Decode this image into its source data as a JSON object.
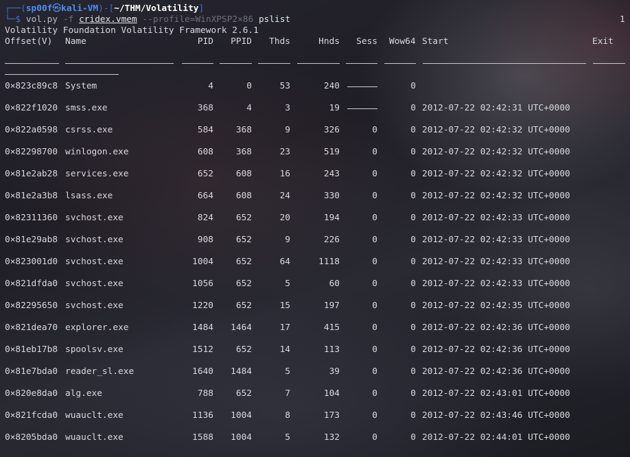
{
  "prompt": {
    "corner_top": "┌──(",
    "user": "sp00f",
    "skull": "㉿",
    "host": "kali-VM",
    "mid": ")-[",
    "path": "~/THM/Volatility",
    "close": "]",
    "corner_bottom": "└─",
    "dollar": "$",
    "cmd_vol": "vol.py",
    "cmd_flag": "-f",
    "cmd_file": "cridex.vmem",
    "cmd_profile": "--profile=WinXPSP2×86",
    "cmd_plugin": "pslist",
    "right_marker": "1"
  },
  "banner": "Volatility Foundation Volatility Framework 2.6.1",
  "headers": {
    "offset": "Offset(V)",
    "name": "Name",
    "pid": "PID",
    "ppid": "PPID",
    "thds": "Thds",
    "hnds": "Hnds",
    "sess": "Sess",
    "wow64": "Wow64",
    "start": "Start",
    "exit": "Exit"
  },
  "rows": [
    {
      "offset": "0×823c89c8",
      "name": "System",
      "pid": "4",
      "ppid": "0",
      "thds": "53",
      "hnds": "240",
      "sess": "",
      "wow64": "0",
      "start": ""
    },
    {
      "offset": "0×822f1020",
      "name": "smss.exe",
      "pid": "368",
      "ppid": "4",
      "thds": "3",
      "hnds": "19",
      "sess": "",
      "wow64": "0",
      "start": "2012-07-22 02:42:31 UTC+0000"
    },
    {
      "offset": "0×822a0598",
      "name": "csrss.exe",
      "pid": "584",
      "ppid": "368",
      "thds": "9",
      "hnds": "326",
      "sess": "0",
      "wow64": "0",
      "start": "2012-07-22 02:42:32 UTC+0000"
    },
    {
      "offset": "0×82298700",
      "name": "winlogon.exe",
      "pid": "608",
      "ppid": "368",
      "thds": "23",
      "hnds": "519",
      "sess": "0",
      "wow64": "0",
      "start": "2012-07-22 02:42:32 UTC+0000"
    },
    {
      "offset": "0×81e2ab28",
      "name": "services.exe",
      "pid": "652",
      "ppid": "608",
      "thds": "16",
      "hnds": "243",
      "sess": "0",
      "wow64": "0",
      "start": "2012-07-22 02:42:32 UTC+0000"
    },
    {
      "offset": "0×81e2a3b8",
      "name": "lsass.exe",
      "pid": "664",
      "ppid": "608",
      "thds": "24",
      "hnds": "330",
      "sess": "0",
      "wow64": "0",
      "start": "2012-07-22 02:42:32 UTC+0000"
    },
    {
      "offset": "0×82311360",
      "name": "svchost.exe",
      "pid": "824",
      "ppid": "652",
      "thds": "20",
      "hnds": "194",
      "sess": "0",
      "wow64": "0",
      "start": "2012-07-22 02:42:33 UTC+0000"
    },
    {
      "offset": "0×81e29ab8",
      "name": "svchost.exe",
      "pid": "908",
      "ppid": "652",
      "thds": "9",
      "hnds": "226",
      "sess": "0",
      "wow64": "0",
      "start": "2012-07-22 02:42:33 UTC+0000"
    },
    {
      "offset": "0×823001d0",
      "name": "svchost.exe",
      "pid": "1004",
      "ppid": "652",
      "thds": "64",
      "hnds": "1118",
      "sess": "0",
      "wow64": "0",
      "start": "2012-07-22 02:42:33 UTC+0000"
    },
    {
      "offset": "0×821dfda0",
      "name": "svchost.exe",
      "pid": "1056",
      "ppid": "652",
      "thds": "5",
      "hnds": "60",
      "sess": "0",
      "wow64": "0",
      "start": "2012-07-22 02:42:33 UTC+0000"
    },
    {
      "offset": "0×82295650",
      "name": "svchost.exe",
      "pid": "1220",
      "ppid": "652",
      "thds": "15",
      "hnds": "197",
      "sess": "0",
      "wow64": "0",
      "start": "2012-07-22 02:42:35 UTC+0000"
    },
    {
      "offset": "0×821dea70",
      "name": "explorer.exe",
      "pid": "1484",
      "ppid": "1464",
      "thds": "17",
      "hnds": "415",
      "sess": "0",
      "wow64": "0",
      "start": "2012-07-22 02:42:36 UTC+0000"
    },
    {
      "offset": "0×81eb17b8",
      "name": "spoolsv.exe",
      "pid": "1512",
      "ppid": "652",
      "thds": "14",
      "hnds": "113",
      "sess": "0",
      "wow64": "0",
      "start": "2012-07-22 02:42:36 UTC+0000"
    },
    {
      "offset": "0×81e7bda0",
      "name": "reader_sl.exe",
      "pid": "1640",
      "ppid": "1484",
      "thds": "5",
      "hnds": "39",
      "sess": "0",
      "wow64": "0",
      "start": "2012-07-22 02:42:36 UTC+0000"
    },
    {
      "offset": "0×820e8da0",
      "name": "alg.exe",
      "pid": "788",
      "ppid": "652",
      "thds": "7",
      "hnds": "104",
      "sess": "0",
      "wow64": "0",
      "start": "2012-07-22 02:43:01 UTC+0000"
    },
    {
      "offset": "0×821fcda0",
      "name": "wuauclt.exe",
      "pid": "1136",
      "ppid": "1004",
      "thds": "8",
      "hnds": "173",
      "sess": "0",
      "wow64": "0",
      "start": "2012-07-22 02:43:46 UTC+0000"
    },
    {
      "offset": "0×8205bda0",
      "name": "wuauclt.exe",
      "pid": "1588",
      "ppid": "1004",
      "thds": "5",
      "hnds": "132",
      "sess": "0",
      "wow64": "0",
      "start": "2012-07-22 02:44:01 UTC+0000"
    }
  ]
}
